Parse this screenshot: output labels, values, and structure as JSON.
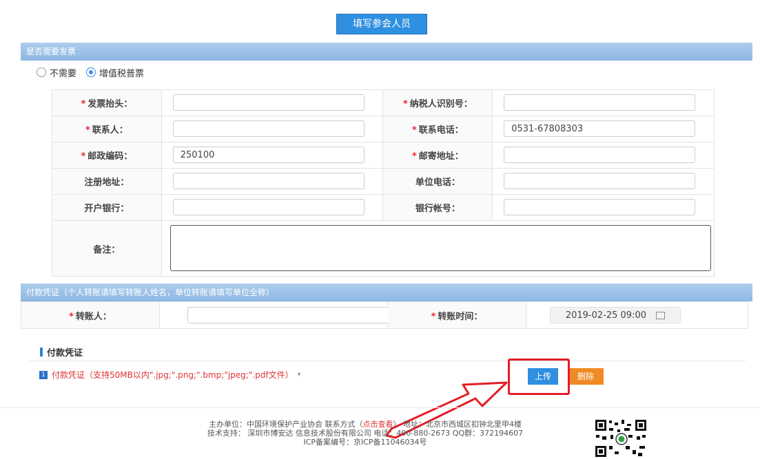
{
  "top_button": "填写参会人员",
  "invoice": {
    "header": "是否需要发票",
    "options": [
      "不需要",
      "增值税普票"
    ],
    "fields": {
      "title_label": "发票抬头：",
      "title_value": "",
      "taxid_label": "纳税人识别号：",
      "taxid_value": "",
      "contact_label": "联系人：",
      "contact_value": "",
      "phone_label": "联系电话：",
      "phone_value": "0531-67808303",
      "zip_label": "邮政编码：",
      "zip_value": "250100",
      "mail_label": "邮寄地址：",
      "mail_value": "",
      "reg_addr_label": "注册地址：",
      "unit_phone_label": "单位电话：",
      "bank_label": "开户银行：",
      "account_label": "银行帐号：",
      "remark_label": "备注："
    }
  },
  "payment": {
    "header": "付款凭证（个人转账请填写转账人姓名，单位转账请填写单位全称）",
    "payer_label": "转账人：",
    "payer_value": "",
    "time_label": "转账时间：",
    "time_value": "2019-02-25 09:00",
    "voucher_title": "付款凭证",
    "file_index": "1",
    "file_label": "付款凭证（支持50MB以内\".jpg;\".png;\".bmp;\"jpeg;\".pdf文件）",
    "upload_label": "上传",
    "delete_label": "删除"
  },
  "footer": {
    "line1_pre": "主办单位：中国环境保护产业协会   联系方式（",
    "line1_link": "点击查看",
    "line1_post": "）   地址：北京市西城区扣钟北里甲4楼",
    "line2": "技术支持： 深圳市博安达 信息技术股份有限公司 电话：400-880-2673 QQ群：372194607",
    "line3": "ICP备案编号：京ICP备11046034号"
  },
  "colors": {
    "accent": "#2f8fe0",
    "header_bar": "#9cc2e8",
    "delete": "#f08a24",
    "highlight": "#e41d25"
  }
}
